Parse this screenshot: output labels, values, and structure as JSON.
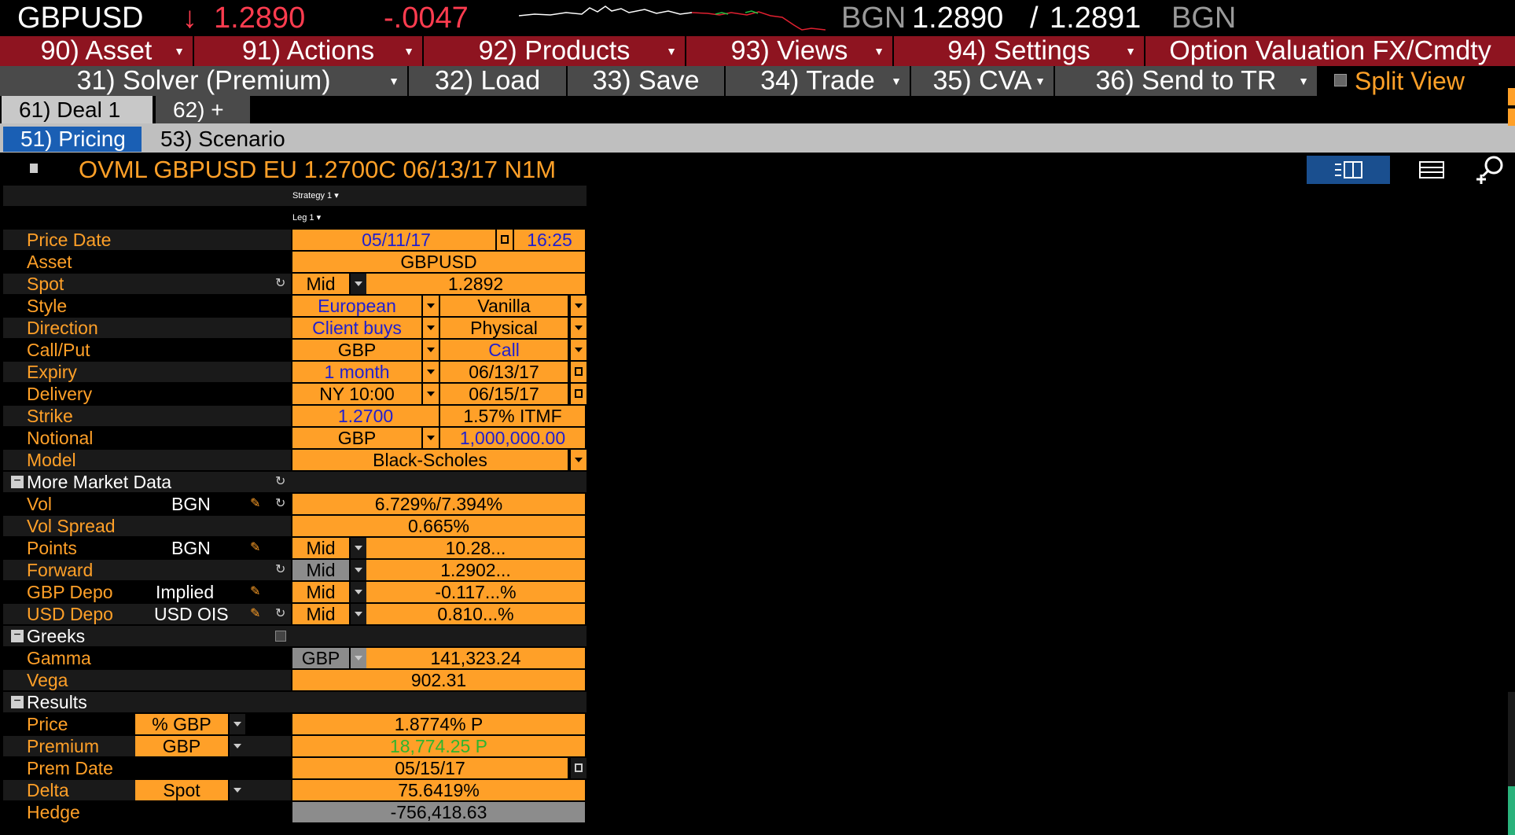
{
  "ticker": {
    "symbol": "GBPUSD",
    "arrow": "↓",
    "last": "1.2890",
    "change": "-.0047",
    "source_left": "BGN",
    "bid": "1.2890",
    "sep": "/",
    "ask": "1.2891",
    "source_right": "BGN",
    "colors": {
      "down": "#ff3c4f",
      "spark": "#ffffff"
    }
  },
  "menu1": [
    {
      "label": "90) Asset"
    },
    {
      "label": "91) Actions"
    },
    {
      "label": "92) Products"
    },
    {
      "label": "93) Views"
    },
    {
      "label": "94) Settings"
    },
    {
      "label": "Option Valuation FX/Cmdty"
    }
  ],
  "menu2": [
    {
      "label": "31) Solver (Premium)"
    },
    {
      "label": "32) Load"
    },
    {
      "label": "33) Save"
    },
    {
      "label": "34) Trade"
    },
    {
      "label": "35) CVA"
    },
    {
      "label": "36) Send to TR"
    }
  ],
  "split_view": "Split View",
  "tabs": [
    "61) Deal 1",
    "62) +"
  ],
  "subtabs": [
    "51) Pricing",
    "53) Scenario"
  ],
  "deal_title": "OVML GBPUSD EU 1.2700C 06/13/17 N1M",
  "strategy_label": "Strategy 1",
  "leg_label": "Leg 1",
  "rows": {
    "price_date": {
      "label": "Price Date",
      "date": "05/11/17",
      "time": "16:25"
    },
    "asset": {
      "label": "Asset",
      "value": "GBPUSD"
    },
    "spot": {
      "label": "Spot",
      "side": "Mid",
      "value": "1.2892"
    },
    "style": {
      "label": "Style",
      "a": "European",
      "b": "Vanilla"
    },
    "direction": {
      "label": "Direction",
      "a": "Client buys",
      "b": "Physical"
    },
    "callput": {
      "label": "Call/Put",
      "a": "GBP",
      "b": "Call"
    },
    "expiry": {
      "label": "Expiry",
      "a": "1 month",
      "b": "06/13/17"
    },
    "delivery": {
      "label": "Delivery",
      "a": "NY 10:00",
      "b": "06/15/17"
    },
    "strike": {
      "label": "Strike",
      "a": "1.2700",
      "b": "1.57% ITMF"
    },
    "notional": {
      "label": "Notional",
      "a": "GBP",
      "b": "1,000,000.00"
    },
    "model": {
      "label": "Model",
      "value": "Black-Scholes"
    }
  },
  "market": {
    "header": "More Market Data",
    "vol": {
      "label": "Vol",
      "src": "BGN",
      "value": "6.729%/7.394%"
    },
    "vol_spread": {
      "label": "Vol Spread",
      "value": "0.665%"
    },
    "points": {
      "label": "Points",
      "src": "BGN",
      "side": "Mid",
      "value": "10.28..."
    },
    "forward": {
      "label": "Forward",
      "side": "Mid",
      "value": "1.2902..."
    },
    "gbp_depo": {
      "label": "GBP Depo",
      "src": "Implied",
      "side": "Mid",
      "value": "-0.117...%"
    },
    "usd_depo": {
      "label": "USD Depo",
      "src": "USD OIS",
      "side": "Mid",
      "value": "0.810...%"
    }
  },
  "greeks": {
    "header": "Greeks",
    "gamma": {
      "label": "Gamma",
      "ccy": "GBP",
      "value": "141,323.24"
    },
    "vega": {
      "label": "Vega",
      "value": "902.31"
    }
  },
  "results": {
    "header": "Results",
    "price": {
      "label": "Price",
      "unit": "% GBP",
      "value": "1.8774% P"
    },
    "premium": {
      "label": "Premium",
      "unit": "GBP",
      "value": "18,774.25 P"
    },
    "prem_date": {
      "label": "Prem Date",
      "value": "05/15/17"
    },
    "delta": {
      "label": "Delta",
      "unit": "Spot",
      "value": "75.6419%"
    },
    "hedge": {
      "label": "Hedge",
      "value": "-756,418.63"
    }
  },
  "icons": {
    "refresh": "↻",
    "pencil": "✎",
    "minus": "−",
    "search_plus": "⌕",
    "columns_view": "columns-view-icon",
    "rows_view": "rows-view-icon"
  }
}
